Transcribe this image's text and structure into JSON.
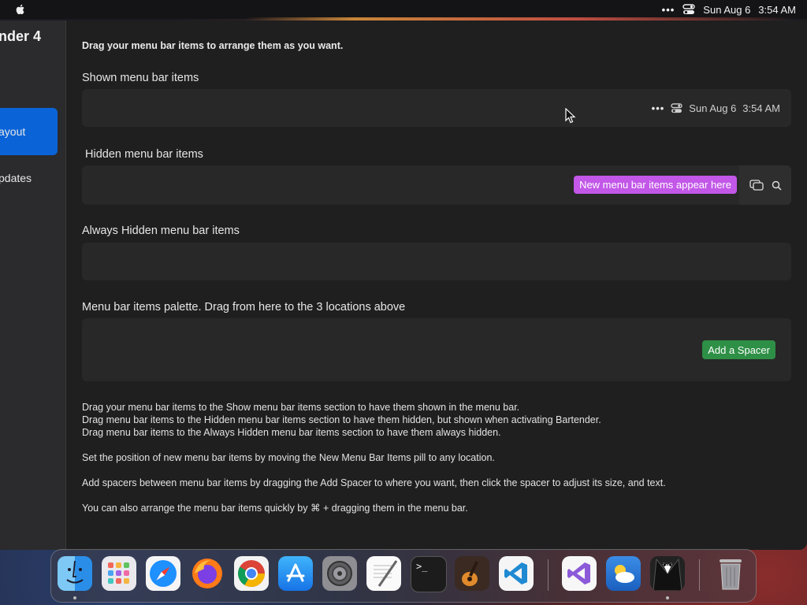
{
  "menubar": {
    "date": "Sun Aug 6",
    "time": "3:54 AM"
  },
  "sidebar": {
    "app_title": "nder 4",
    "items": [
      {
        "label": "ayout",
        "active": true
      },
      {
        "label": "pdates",
        "active": false
      }
    ]
  },
  "main": {
    "intro": "Drag your menu bar items to arrange them as you want.",
    "shown": {
      "title": "Shown menu bar items",
      "date": "Sun Aug 6",
      "time": "3:54 AM"
    },
    "hidden": {
      "title": "Hidden menu bar items",
      "pill": "New menu bar items appear here"
    },
    "always_hidden": {
      "title": "Always Hidden menu bar items"
    },
    "palette": {
      "title": "Menu bar items palette. Drag from here to the 3 locations above",
      "add_spacer": "Add a Spacer"
    },
    "descriptions": [
      "Drag your menu bar items to the Show menu bar items section to have them shown in the menu bar.",
      "Drag menu bar items to the Hidden menu bar items section to have them hidden, but shown when activating Bartender.",
      "Drag menu bar items to the Always Hidden menu bar items section to have them always hidden.",
      "Set the position of new menu bar items by moving the New Menu Bar Items pill to any location.",
      "Add spacers between menu bar items by dragging the Add Spacer to where you want, then click the spacer to adjust its size, and text.",
      "You can also arrange the menu bar items quickly by ⌘ + dragging them in the menu bar."
    ]
  },
  "colors": {
    "accent_blue": "#0a64d8",
    "pill_purple": "#c257e8",
    "spacer_green": "#2e8f46"
  },
  "dock": {
    "apps": [
      "finder-icon",
      "launchpad-icon",
      "safari-icon",
      "firefox-icon",
      "chrome-icon",
      "app-store-icon",
      "system-settings-icon",
      "textedit-icon",
      "terminal-icon",
      "garageband-icon",
      "vscode-icon",
      "visual-studio-icon",
      "weather-icon",
      "bartender-icon",
      "trash-icon"
    ]
  }
}
